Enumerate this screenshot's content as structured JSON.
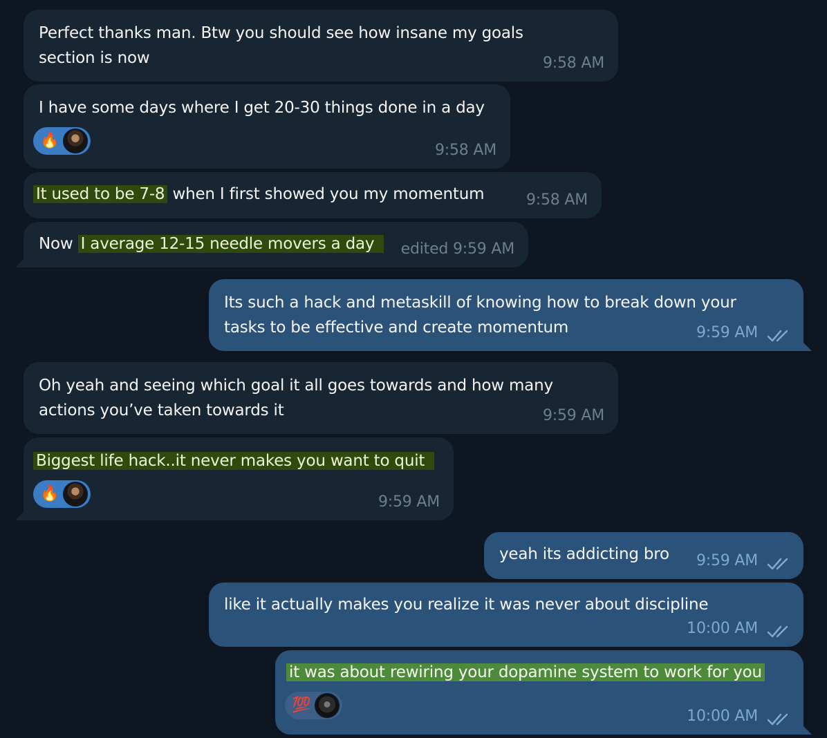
{
  "messages": [
    {
      "text": "Perfect thanks man. Btw you should see how insane my goals section is now",
      "time": "9:58 AM"
    },
    {
      "text": "I have some days where I get 20-30 things done in a day",
      "time": "9:58 AM",
      "reactions": {
        "emoji": "🔥",
        "icon": "fire-icon"
      }
    },
    {
      "highlight": "It used to be 7-8",
      "text": " when I first showed you my momentum",
      "time": "9:58 AM"
    },
    {
      "prefix": "Now ",
      "highlight": "I average 12-15 needle movers a day",
      "time": "edited 9:59 AM"
    },
    {
      "text": "Its such a hack and metaskill of knowing how to break down your tasks to be effective and create momentum",
      "time": "9:59 AM"
    },
    {
      "text": "Oh yeah and seeing which goal it all goes towards and how many actions you’ve taken towards it",
      "time": "9:59 AM"
    },
    {
      "highlight": "Biggest life hack..it never makes you want to quit",
      "time": "9:59 AM",
      "reactions": {
        "emoji": "🔥",
        "icon": "fire-icon"
      }
    },
    {
      "text": "yeah its addicting bro",
      "time": "9:59 AM"
    },
    {
      "text": "like it actually makes you realize it was never about discipline",
      "time": "10:00 AM"
    },
    {
      "highlight": "it was about rewiring your dopamine system to work for you",
      "time": "10:00 AM",
      "reactions": {
        "emoji": "💯",
        "icon": "hundred-points-icon"
      }
    }
  ],
  "colors": {
    "background": "#0e1621",
    "incoming_bubble": "#182533",
    "outgoing_bubble": "#2b5278",
    "highlight": "#2f4a0c",
    "read_check": "#7da8d3"
  }
}
